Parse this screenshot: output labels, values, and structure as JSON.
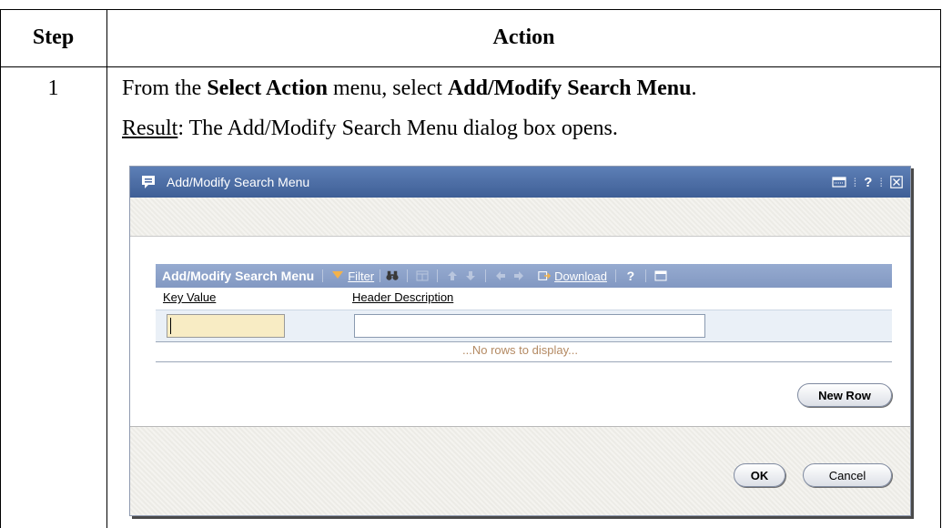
{
  "table": {
    "header_step": "Step",
    "header_action": "Action",
    "step_number": "1",
    "instruction": {
      "prefix": "From the ",
      "menu_name": "Select Action",
      "middle": " menu, select ",
      "item_name": "Add/Modify Search Menu",
      "suffix": "."
    },
    "result": {
      "label": "Result",
      "text": ": The Add/Modify Search Menu dialog box opens."
    }
  },
  "dialog": {
    "title": "Add/Modify Search Menu",
    "title_icon": "dialog-icon",
    "controls": [
      "window-icon",
      "help-icon",
      "close-icon"
    ],
    "help_glyph": "?",
    "grid": {
      "title": "Add/Modify Search Menu",
      "filter_label": "Filter",
      "download_label": "Download",
      "help_glyph": "?",
      "icons": [
        "filter-icon",
        "binoculars-icon",
        "columns-icon",
        "arrow-up-icon",
        "arrow-down-icon",
        "arrow-left-icon",
        "arrow-right-icon",
        "download-icon",
        "help-icon",
        "window-icon"
      ],
      "columns": [
        "Key Value",
        "Header Description"
      ],
      "row": {
        "key_value": "",
        "header_description": ""
      },
      "empty_message": "...No rows to display..."
    },
    "new_row_button": "New Row",
    "ok_button": "OK",
    "cancel_button": "Cancel",
    "colors": {
      "titlebar": "#4f6fa6",
      "gridbar": "#8ca2c9",
      "key_field": "#f8ecc4",
      "empty_message": "#b48a63"
    }
  }
}
